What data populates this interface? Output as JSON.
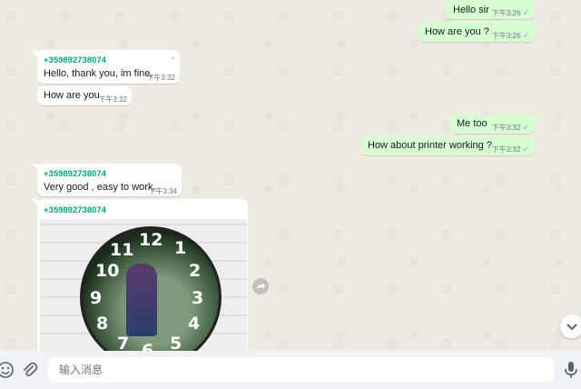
{
  "messages": {
    "m1": {
      "text": "Hello sir",
      "time": "下午3:26"
    },
    "m2": {
      "text": "How are you ?",
      "time": "下午3:26"
    },
    "m3": {
      "sender": "+359892738074",
      "text": "Hello, thank you, im fine.",
      "time": "下午3:32"
    },
    "m4": {
      "text": "How are you",
      "time": "下午3:32"
    },
    "m5": {
      "text": "Me too",
      "time": "下午3:32"
    },
    "m6": {
      "text": "How about printer working ?",
      "time": "下午3:32"
    },
    "m7": {
      "sender": "+359892738074",
      "text": "Very good , easy to work.",
      "time": "下午3:34"
    },
    "m8": {
      "sender": "+359892738074"
    }
  },
  "clock_numbers": [
    "12",
    "1",
    "2",
    "3",
    "4",
    "5",
    "6",
    "7",
    "8",
    "9",
    "10",
    "11"
  ],
  "input": {
    "placeholder": "输入消息"
  },
  "icons": {
    "emoji": "emoji-icon",
    "attach": "paperclip-icon",
    "mic": "microphone-icon",
    "scroll": "chevron-down-icon",
    "forward": "forward-icon"
  },
  "colors": {
    "outgoing": "#d9fdd3",
    "incoming": "#ffffff",
    "sender": "#06a77d",
    "background": "#efeae2",
    "tick": "#53bdeb"
  }
}
